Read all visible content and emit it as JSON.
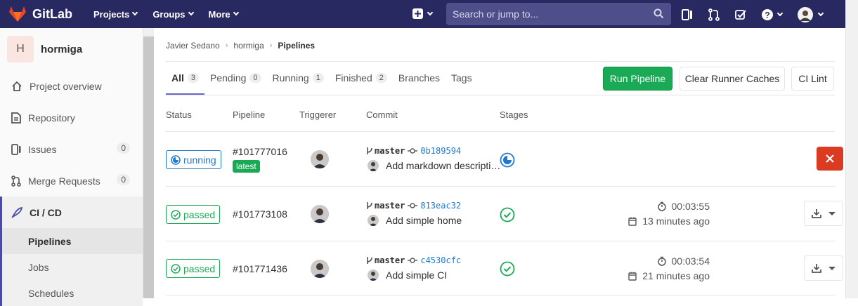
{
  "navbar": {
    "brand": "GitLab",
    "menu": [
      "Projects",
      "Groups",
      "More"
    ],
    "search_placeholder": "Search or jump to..."
  },
  "sidebar": {
    "project_initial": "H",
    "project_name": "hormiga",
    "items": [
      {
        "label": "Project overview"
      },
      {
        "label": "Repository"
      },
      {
        "label": "Issues",
        "count": "0"
      },
      {
        "label": "Merge Requests",
        "count": "0"
      },
      {
        "label": "CI / CD"
      }
    ],
    "subitems": [
      "Pipelines",
      "Jobs",
      "Schedules"
    ]
  },
  "breadcrumb": [
    "Javier Sedano",
    "hormiga",
    "Pipelines"
  ],
  "tabs": [
    {
      "label": "All",
      "count": "3"
    },
    {
      "label": "Pending",
      "count": "0"
    },
    {
      "label": "Running",
      "count": "1"
    },
    {
      "label": "Finished",
      "count": "2"
    },
    {
      "label": "Branches"
    },
    {
      "label": "Tags"
    }
  ],
  "buttons": {
    "run_pipeline": "Run Pipeline",
    "clear_cache": "Clear Runner Caches",
    "ci_lint": "CI Lint"
  },
  "table": {
    "headers": [
      "Status",
      "Pipeline",
      "Triggerer",
      "Commit",
      "Stages"
    ],
    "rows": [
      {
        "status": "running",
        "pipeline": "#101777016",
        "tag": "latest",
        "branch": "master",
        "sha": "0b189594",
        "message": "Add markdown descripti…",
        "duration": "",
        "finished": ""
      },
      {
        "status": "passed",
        "pipeline": "#101773108",
        "branch": "master",
        "sha": "813eac32",
        "message": "Add simple home",
        "duration": "00:03:55",
        "finished": "13 minutes ago"
      },
      {
        "status": "passed",
        "pipeline": "#101771436",
        "branch": "master",
        "sha": "c4530cfc",
        "message": "Add simple CI",
        "duration": "00:03:54",
        "finished": "21 minutes ago"
      }
    ]
  },
  "colors": {
    "navbar": "#292961",
    "running": "#1f78d1",
    "passed": "#1aaa55",
    "cancel": "#db3b21"
  }
}
